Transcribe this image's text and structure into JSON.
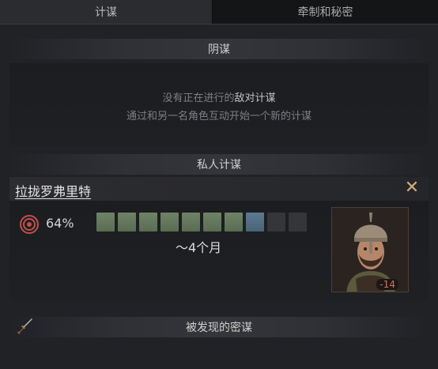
{
  "tabs": [
    {
      "label": "计谋",
      "active": true
    },
    {
      "label": "牵制和秘密",
      "active": false
    }
  ],
  "hostile": {
    "header": "阴谋",
    "empty_prefix": "没有正在进行的",
    "empty_highlight": "敌对计谋",
    "empty_line2": "通过和另一名角色互动开始一个新的计谋"
  },
  "personal": {
    "header": "私人计谋",
    "scheme_name": "拉拢罗弗里特",
    "success_chance": "64%",
    "progress": {
      "completed": 7,
      "current": 1,
      "total": 10
    },
    "duration": "～4个月",
    "target_opinion": "-14"
  },
  "discovered": {
    "header": "被发现的密谋"
  },
  "colors": {
    "accent_gold": "#d2b07a",
    "progress_done": "#6f8466",
    "progress_current": "#5c7a93",
    "negative": "#d87060"
  },
  "icons": {
    "close": "close-icon",
    "target": "target-icon",
    "dagger": "dagger-icon"
  }
}
